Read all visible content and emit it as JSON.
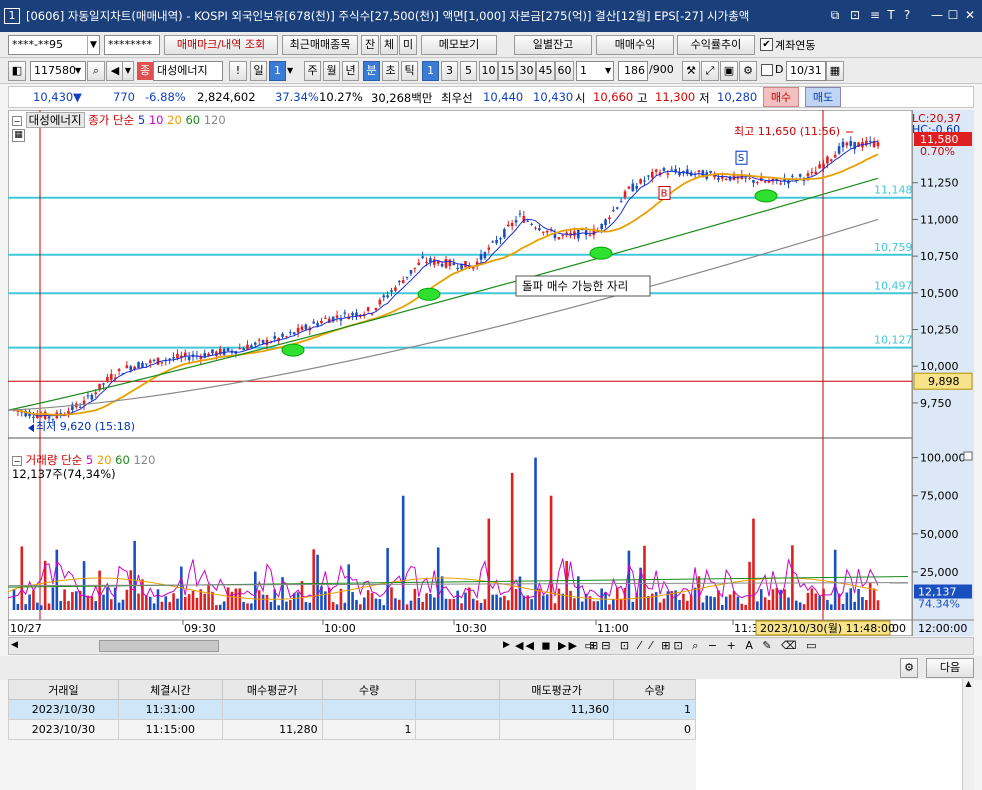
{
  "title": {
    "num": "1",
    "text": "[0606] 자동일지차트(매매내역) - KOSPI 외국인보유[678(천)] 주식수[27,500(천)] 액면[1,000] 자본금[275(억)] 결산[12월] EPS[-27] 시가총액"
  },
  "row1": {
    "account": "****-**95",
    "password": "********",
    "btn_trade_mark": "매매마크/내역 조회",
    "btn_recent": "최근매매종목",
    "tab_jan": "잔",
    "tab_che": "체",
    "tab_mi": "미",
    "btn_memo": "메모보기",
    "btn_daily": "일별잔고",
    "btn_profit": "매매수익",
    "btn_return": "수익률추이",
    "chk_account": "계좌연동"
  },
  "row2": {
    "code": "117580",
    "search_icon": "🔍",
    "name_prefix": "종",
    "name": "대성에너지",
    "excl": "!",
    "day": "일",
    "num1": "1",
    "ju": "주",
    "wol": "월",
    "nyeon": "년",
    "bun": "분",
    "cho": "초",
    "tik": "틱",
    "intervals": [
      "1",
      "3",
      "5",
      "10",
      "15",
      "30",
      "45",
      "60"
    ],
    "period": "1",
    "count": "186",
    "total": "/900",
    "d_label": "D",
    "date": "10/31"
  },
  "quote": {
    "price": "10,430",
    "arrow": "▼",
    "change": "770",
    "pct": "-6.88%",
    "volume": "2,824,602",
    "ratio1": "37.34%",
    "ratio2": "10.27%",
    "amount": "30,268백만",
    "best_label": "최우선",
    "bid": "10,440",
    "ask": "10,430",
    "open_label": "시",
    "open": "10,660",
    "high_label": "고",
    "high": "11,300",
    "low_label": "저",
    "low": "10,280",
    "buy_btn": "매수",
    "sell_btn": "매도"
  },
  "legend_price": {
    "name": "대성에너지",
    "ma_label": "종가 단순",
    "p5": "5",
    "p10": "10",
    "p20": "20",
    "p60": "60",
    "p120": "120"
  },
  "legend_vol": {
    "name": "거래량",
    "ma_label": "단순",
    "p5": "5",
    "p20": "20",
    "p60": "60",
    "p120": "120",
    "current": "12,137주(74,34%)"
  },
  "annotations": {
    "high_text": "최고 11,650 (11:56)",
    "low_text": "최저 9,620 (15:18)",
    "breakout_box": "돌파 매수 가능한 자리",
    "lc": "LC:20,37",
    "hc": "HC:-0.60",
    "cur_price": "11,580",
    "cur_pct": "0.70%",
    "crosshair_price": "9,898",
    "crosshair_time": "2023/10/30(월) 11:48:00",
    "marker_b": "B",
    "marker_s": "S",
    "vol_cur": "12,137",
    "vol_pct": "74.34%"
  },
  "levels": [
    {
      "value": "11,148"
    },
    {
      "value": "10,759"
    },
    {
      "value": "10,497"
    },
    {
      "value": "10,127"
    }
  ],
  "price_axis": [
    "11,250",
    "11,000",
    "10,750",
    "10,500",
    "10,250",
    "10,000",
    "9,750"
  ],
  "vol_axis": [
    "100,000",
    "75,000",
    "50,000",
    "25,000"
  ],
  "time_axis": {
    "start": "10/27",
    "ticks": [
      "09:30",
      "10:00",
      "10:30",
      "11:00",
      "11:3"
    ],
    "t1": "00",
    "t2": "12:00:00"
  },
  "bottom": {
    "next": "다음"
  },
  "table": {
    "headers": [
      "거래일",
      "체결시간",
      "매수평균가",
      "수량",
      "",
      "매도평균가",
      "수량"
    ],
    "rows": [
      [
        "2023/10/30",
        "11:31:00",
        "",
        "",
        "",
        "11,360",
        "1"
      ],
      [
        "2023/10/30",
        "11:15:00",
        "11,280",
        "1",
        "",
        "",
        "0"
      ]
    ]
  },
  "colors": {
    "title_bg": "#1b3f7a",
    "up": "#e02020",
    "down": "#1a4fc0",
    "ma5": "#1a2fd0",
    "ma20": "#e8a000",
    "ma60": "#1a8a1a",
    "ma120": "#888888",
    "ma10": "#cc00cc",
    "level": "#40c8d8"
  }
}
